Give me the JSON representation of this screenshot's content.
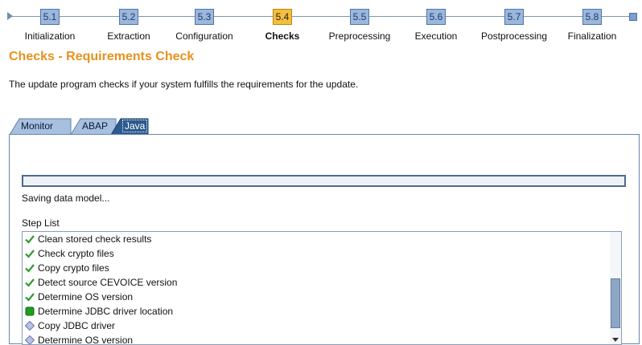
{
  "roadmap": {
    "steps": [
      {
        "num": "5.1",
        "label": "Initialization"
      },
      {
        "num": "5.2",
        "label": "Extraction"
      },
      {
        "num": "5.3",
        "label": "Configuration"
      },
      {
        "num": "5.4",
        "label": "Checks",
        "active": true
      },
      {
        "num": "5.5",
        "label": "Preprocessing"
      },
      {
        "num": "5.6",
        "label": "Execution"
      },
      {
        "num": "5.7",
        "label": "Postprocessing"
      },
      {
        "num": "5.8",
        "label": "Finalization"
      }
    ]
  },
  "page": {
    "title": "Checks - Requirements Check",
    "description": "The update program checks if your system fulfills the requirements for the update."
  },
  "tabs": [
    {
      "label": "Monitor"
    },
    {
      "label": "ABAP"
    },
    {
      "label": "Java",
      "active": true
    }
  ],
  "panel": {
    "progress_fraction": 0.0,
    "status_text": "Saving data model...",
    "step_list_label": "Step List",
    "steps": [
      {
        "label": "Clean stored check results",
        "icon": "check-icon"
      },
      {
        "label": "Check crypto files",
        "icon": "check-icon"
      },
      {
        "label": "Copy crypto files",
        "icon": "check-icon"
      },
      {
        "label": "Detect source CEVOICE version",
        "icon": "check-icon"
      },
      {
        "label": "Determine OS version",
        "icon": "check-icon"
      },
      {
        "label": "Determine JDBC driver location",
        "icon": "in-progress-icon"
      },
      {
        "label": "Copy JDBC driver",
        "icon": "pending-icon"
      },
      {
        "label": "Determine OS version",
        "icon": "pending-icon"
      }
    ]
  },
  "colors": {
    "title": "#e8911e",
    "active_step": "#f5bf3c",
    "step": "#9bb7de",
    "check": "#2f9a2f",
    "in_progress": "#1e9e1e",
    "pending": "#b9c3e6"
  }
}
